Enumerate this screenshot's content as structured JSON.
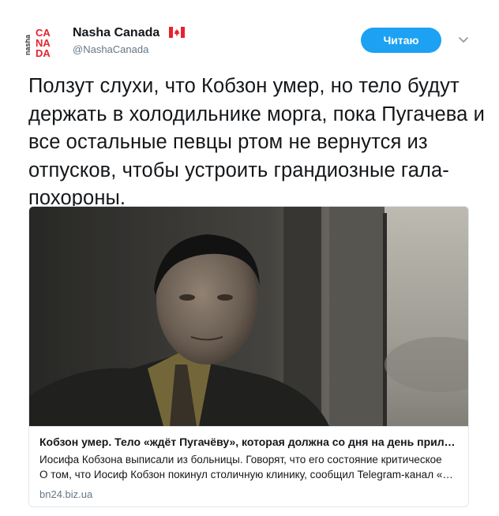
{
  "tweet": {
    "author": {
      "display_name": "Nasha Canada",
      "flag_icon": "canada-flag-icon",
      "handle": "@NashaCanada",
      "avatar_logo_text": "nasha CANADA"
    },
    "follow_button_label": "Читаю",
    "menu_icon": "chevron-down-icon",
    "text": "Ползут слухи, что Кобзон умер, но тело будут держать в холодильнике морга, пока Пугачева и все остальные певцы ртом не вернутся из отпусков, чтобы устроить грандиозные гала-похороны.",
    "card": {
      "title": "Кобзон умер. Тело «ждёт Пугачёву», которая должна со дня на день прилететь",
      "description_line1": "Иосифа Кобзона выписали из больницы. Говорят, что его состояние критическое",
      "description_line2": "О том, что Иосиф Кобзон покинул столичную клинику, сообщил Telegram-канал «Mash»",
      "domain": "bn24.biz.ua"
    }
  },
  "colors": {
    "follow_button": "#1da1f2",
    "brand_red": "#e8212e",
    "handle_gray": "#657786",
    "card_border": "#e1e8ed"
  }
}
